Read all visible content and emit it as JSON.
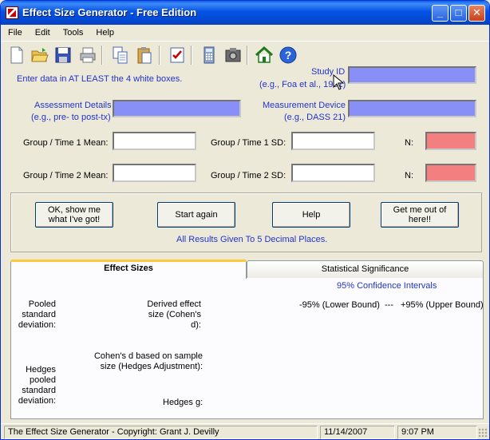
{
  "window": {
    "title": "Effect Size Generator - Free Edition",
    "controls": {
      "minimize": "_",
      "maximize": "□",
      "close": "✕"
    }
  },
  "menu": [
    "File",
    "Edit",
    "Tools",
    "Help"
  ],
  "toolbar_icons": [
    "new-document-icon",
    "open-folder-icon",
    "save-disk-icon",
    "print-icon",
    "copy-icon",
    "paste-icon",
    "checklist-icon",
    "calculator-icon",
    "camera-icon",
    "home-icon",
    "help-icon"
  ],
  "form": {
    "instruction": "Enter data in AT LEAST the 4 white boxes.",
    "study_id": {
      "label": "Study ID",
      "hint": "(e.g., Foa et al., 1991)",
      "value": ""
    },
    "assessment": {
      "label": "Assessment Details",
      "hint": "(e.g., pre- to post-tx)",
      "value": ""
    },
    "measurement": {
      "label": "Measurement Device",
      "hint": "(e.g., DASS 21)",
      "value": ""
    },
    "g1_mean": {
      "label": "Group / Time 1 Mean:",
      "value": ""
    },
    "g1_sd": {
      "label": "Group / Time 1 SD:",
      "value": ""
    },
    "g1_n": {
      "label": "N:",
      "value": ""
    },
    "g2_mean": {
      "label": "Group / Time 2 Mean:",
      "value": ""
    },
    "g2_sd": {
      "label": "Group / Time 2 SD:",
      "value": ""
    },
    "g2_n": {
      "label": "N:",
      "value": ""
    }
  },
  "buttons": {
    "show": "OK, show me what I've got!",
    "start_again": "Start again",
    "help": "Help",
    "exit": "Get me out of here!!",
    "decimal_note": "All Results Given To 5 Decimal Places."
  },
  "tabs": {
    "effect_sizes": "Effect Sizes",
    "significance": "Statistical Significance"
  },
  "results": {
    "ci_title": "95% Confidence Intervals",
    "lower": "-95% (Lower Bound)",
    "dashes": "---",
    "upper": "+95% (Upper Bound)",
    "pooled_sd": "Pooled standard deviation:",
    "derived": "Derived effect size (Cohen's d):",
    "cohens_hedges": "Cohen's d based on sample size (Hedges Adjustment):",
    "hedges_pooled": "Hedges pooled standard deviation:",
    "hedges_g": "Hedges g:"
  },
  "status": {
    "copyright": "The Effect Size Generator - Copyright: Grant J. Devilly",
    "date": "11/14/2007",
    "time": "9:07 PM"
  },
  "colors": {
    "titlebar": "#0553e4",
    "lavender_field": "#8890f8",
    "red_field": "#f47f80",
    "link_blue": "#2233cc"
  }
}
